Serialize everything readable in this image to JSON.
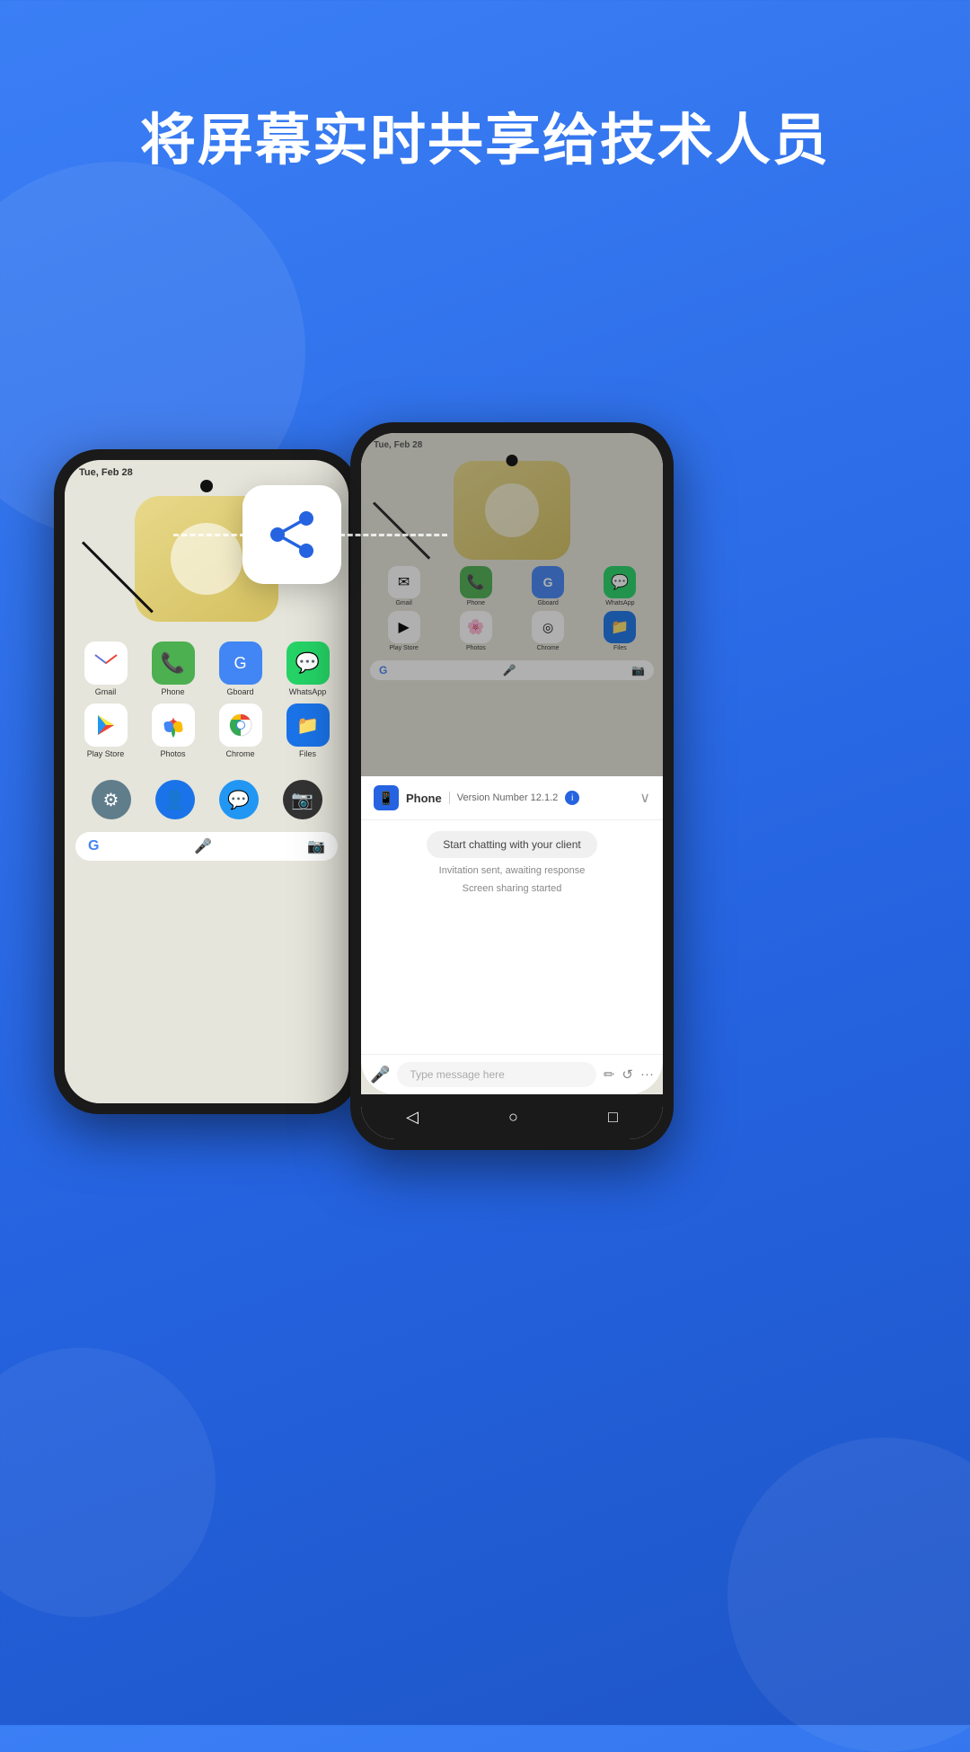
{
  "page": {
    "title": "将屏幕实时共享给技术人员",
    "background_color": "#2563e0"
  },
  "share_icon": {
    "label": "share-icon"
  },
  "left_phone": {
    "status_bar": "Tue, Feb 28",
    "apps": [
      {
        "name": "Gmail",
        "icon": "✉",
        "color": "#fff"
      },
      {
        "name": "Phone",
        "icon": "📞",
        "color": "#4caf50"
      },
      {
        "name": "Gboard",
        "icon": "⌨",
        "color": "#fff"
      },
      {
        "name": "WhatsApp",
        "icon": "💬",
        "color": "#25d366"
      },
      {
        "name": "Play Store",
        "icon": "▶",
        "color": "#fff"
      },
      {
        "name": "Photos",
        "icon": "🌸",
        "color": "#fff"
      },
      {
        "name": "Chrome",
        "icon": "◎",
        "color": "#fff"
      },
      {
        "name": "Files",
        "icon": "📁",
        "color": "#1a73e8"
      }
    ],
    "dock_icons": [
      "⚙",
      "👤",
      "💬",
      "📷"
    ],
    "search_placeholder": "Google"
  },
  "right_phone": {
    "status_bar": "Tue, Feb 28",
    "chat_header": {
      "app_name": "Phone",
      "separator": "|",
      "version_label": "Version Number 12.1.2"
    },
    "chat_messages": [
      {
        "type": "bubble",
        "text": "Start chatting with your client"
      },
      {
        "type": "status",
        "text": "Invitation sent, awaiting response"
      },
      {
        "type": "status",
        "text": "Screen sharing started"
      }
    ],
    "input_placeholder": "Type message here"
  },
  "nav_bar": {
    "back": "◁",
    "home": "○",
    "recent": "□"
  }
}
